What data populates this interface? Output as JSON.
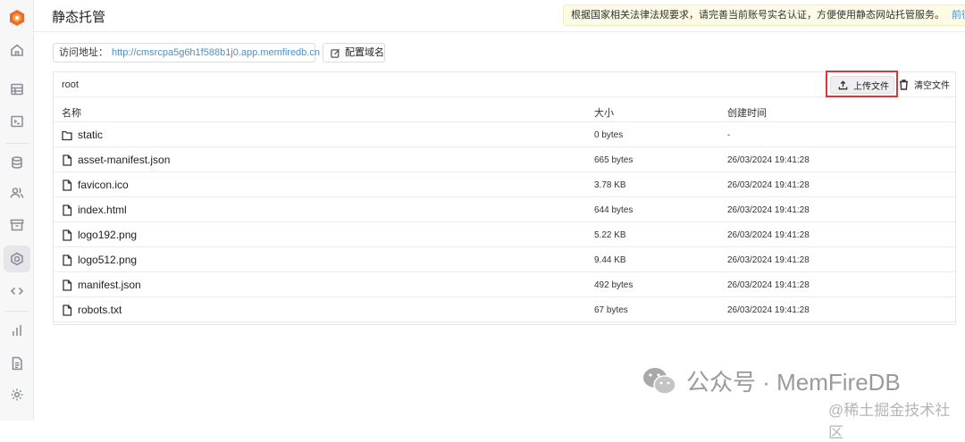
{
  "app": {
    "page_title": "静态托管"
  },
  "notice": {
    "text": "根据国家相关法律法规要求，请完善当前账号实名认证，方便使用静态网站托管服务。",
    "link": "前往认证"
  },
  "access": {
    "label": "访问地址：",
    "url": "http://cmsrcpa5g6h1f588b1j0.app.memfiredb.cn",
    "domain_button": "配置域名"
  },
  "browser": {
    "path": "root",
    "upload_label": "上传文件",
    "clear_label": "清空文件",
    "columns": {
      "name": "名称",
      "size": "大小",
      "created": "创建时间"
    },
    "rows": [
      {
        "type": "folder",
        "name": "static",
        "size": "0 bytes",
        "created": "-"
      },
      {
        "type": "file",
        "name": "asset-manifest.json",
        "size": "665 bytes",
        "created": "26/03/2024 19:41:28"
      },
      {
        "type": "file",
        "name": "favicon.ico",
        "size": "3.78 KB",
        "created": "26/03/2024 19:41:28"
      },
      {
        "type": "file",
        "name": "index.html",
        "size": "644 bytes",
        "created": "26/03/2024 19:41:28"
      },
      {
        "type": "file",
        "name": "logo192.png",
        "size": "5.22 KB",
        "created": "26/03/2024 19:41:28"
      },
      {
        "type": "file",
        "name": "logo512.png",
        "size": "9.44 KB",
        "created": "26/03/2024 19:41:28"
      },
      {
        "type": "file",
        "name": "manifest.json",
        "size": "492 bytes",
        "created": "26/03/2024 19:41:28"
      },
      {
        "type": "file",
        "name": "robots.txt",
        "size": "67 bytes",
        "created": "26/03/2024 19:41:28"
      }
    ]
  },
  "sidebar": {
    "icons": [
      "home-icon",
      "table-icon",
      "terminal-icon",
      "database-icon",
      "users-icon",
      "archive-icon",
      "hosting-icon",
      "code-icon",
      "chart-icon",
      "document-icon",
      "settings-icon"
    ],
    "active": "hosting-icon"
  },
  "watermark": {
    "main": "公众号 · MemFireDB",
    "sub": "@稀土掘金技术社区"
  },
  "colors": {
    "accent": "#4a90c8",
    "highlight": "#d9363e",
    "notice_bg": "#fdfbe6"
  }
}
